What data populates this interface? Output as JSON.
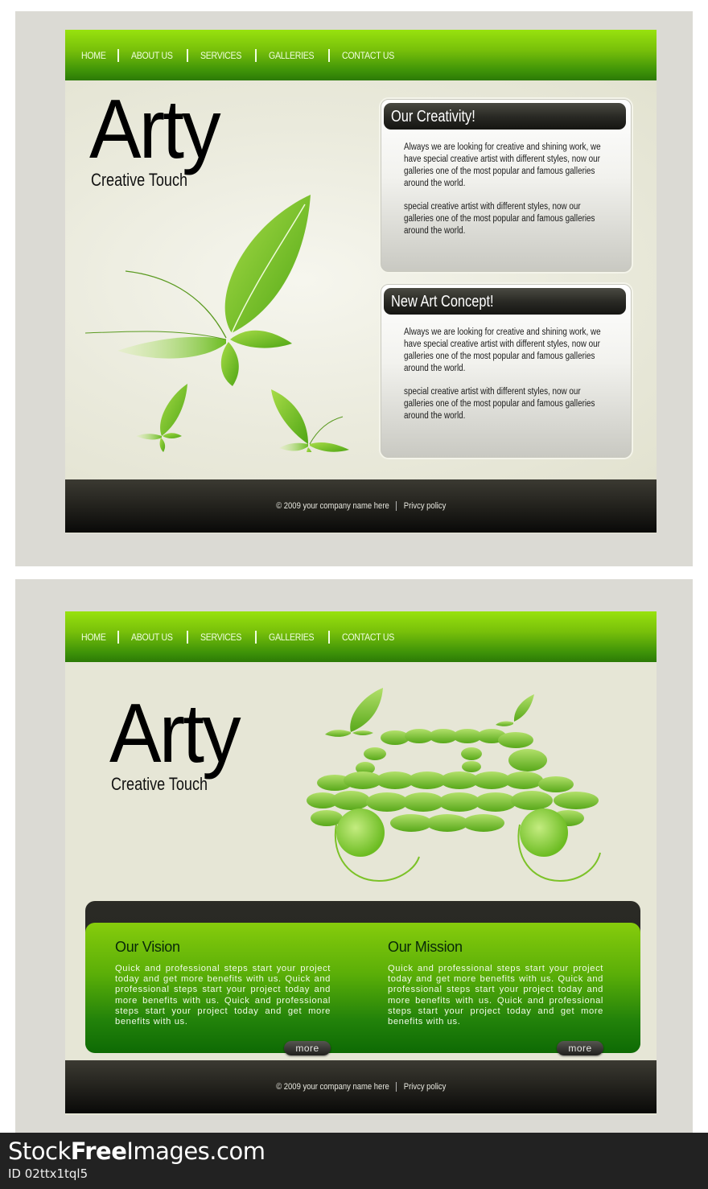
{
  "nav": {
    "items": [
      "HOME",
      "ABOUT US",
      "SERVICES",
      "GALLERIES",
      "CONTACT US"
    ]
  },
  "logo": {
    "title": "Arty",
    "subtitle": "Creative Touch"
  },
  "layout1": {
    "cards": [
      {
        "title": "Our Creativity!",
        "paragraphs": [
          "Always we are looking for creative and shining work, we have special creative artist with different styles, now our galleries one of the most popular and famous galleries around the world.",
          "special creative artist with different styles, now our galleries one of the most popular and famous galleries around the world."
        ]
      },
      {
        "title": "New Art Concept!",
        "paragraphs": [
          "Always we are looking for creative and shining work, we have special creative artist with different styles, now our galleries one of the most popular and famous galleries around the world.",
          "special creative artist with different styles, now our galleries one of the most popular and famous galleries around the world."
        ]
      }
    ],
    "illustration": "leaf-butterflies"
  },
  "layout2": {
    "illustration": "leaf-car",
    "columns": [
      {
        "title": "Our Vision",
        "text": "Quick and professional steps start your project today and get more benefits with us. Quick and professional steps start your project today and more benefits with us. Quick and professional steps start your project today and get more benefits with us.",
        "button": "more"
      },
      {
        "title": "Our Mission",
        "text": "Quick and professional steps start your project today and get more benefits with us. Quick and professional steps start your project today and more benefits with us. Quick and professional steps start your project today and get more benefits with us.",
        "button": "more"
      }
    ]
  },
  "footer": {
    "copyright": "© 2009 your company name here",
    "privacy": "Privcy policy"
  },
  "watermark": {
    "brand_pre": "Stock",
    "brand_bold": "Free",
    "brand_post": "Images.com",
    "id": "ID 02ttx1tql5"
  },
  "colors": {
    "nav_green": "#78c00a",
    "footer_dark": "#23221d",
    "panel_green": "#5aae08",
    "background": "#e6e6d6",
    "frame": "#dbdad4"
  }
}
